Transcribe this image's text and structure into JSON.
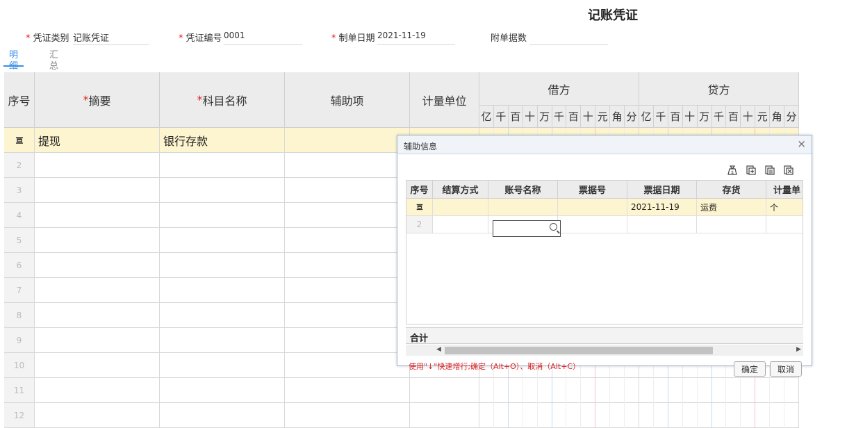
{
  "title": "记账凭证",
  "header": {
    "type_label": "凭证类别",
    "type_value": "记账凭证",
    "number_label": "凭证编号",
    "number_value": "0001",
    "date_label": "制单日期",
    "date_value": "2021-11-19",
    "attach_label": "附单据数",
    "attach_value": ""
  },
  "tabs": [
    {
      "label": "明细",
      "active": true
    },
    {
      "label": "汇总",
      "active": false
    }
  ],
  "columns": {
    "seq": "序号",
    "summary": "摘要",
    "account": "科目名称",
    "aux": "辅助项",
    "unit": "计量单位",
    "debit": "借方",
    "credit": "贷方"
  },
  "digit_units": [
    "亿",
    "千",
    "百",
    "十",
    "万",
    "千",
    "百",
    "十",
    "元",
    "角",
    "分"
  ],
  "rows": [
    {
      "seq": "",
      "summary": "提现",
      "account": "银行存款"
    },
    {
      "seq": "2",
      "summary": "",
      "account": ""
    },
    {
      "seq": "3",
      "summary": "",
      "account": ""
    },
    {
      "seq": "4",
      "summary": "",
      "account": ""
    },
    {
      "seq": "5",
      "summary": "",
      "account": ""
    },
    {
      "seq": "6",
      "summary": "",
      "account": ""
    },
    {
      "seq": "7",
      "summary": "",
      "account": ""
    },
    {
      "seq": "8",
      "summary": "",
      "account": ""
    },
    {
      "seq": "9",
      "summary": "",
      "account": ""
    },
    {
      "seq": "10",
      "summary": "",
      "account": ""
    },
    {
      "seq": "11",
      "summary": "",
      "account": ""
    },
    {
      "seq": "12",
      "summary": "",
      "account": ""
    }
  ],
  "dialog": {
    "title": "辅助信息",
    "close": "×",
    "columns": [
      "序号",
      "结算方式",
      "账号名称",
      "票据号",
      "票据日期",
      "存货",
      "计量单"
    ],
    "rows": [
      {
        "seq": "",
        "settle": "",
        "account_name": "",
        "bill_no": "",
        "bill_date": "2021-11-19",
        "stock": "运费",
        "unit": "个"
      },
      {
        "seq": "2",
        "settle": "",
        "account_name": "",
        "bill_no": "",
        "bill_date": "",
        "stock": "",
        "unit": ""
      }
    ],
    "total_label": "合计",
    "hint": "使用\"↓\"快速增行;确定（Alt+O）、取消（Alt+C）",
    "ok_label": "确定",
    "cancel_label": "取消",
    "toolbar_icons": [
      "money-bag-icon",
      "add-row-icon",
      "copy-row-icon",
      "delete-row-icon"
    ]
  }
}
